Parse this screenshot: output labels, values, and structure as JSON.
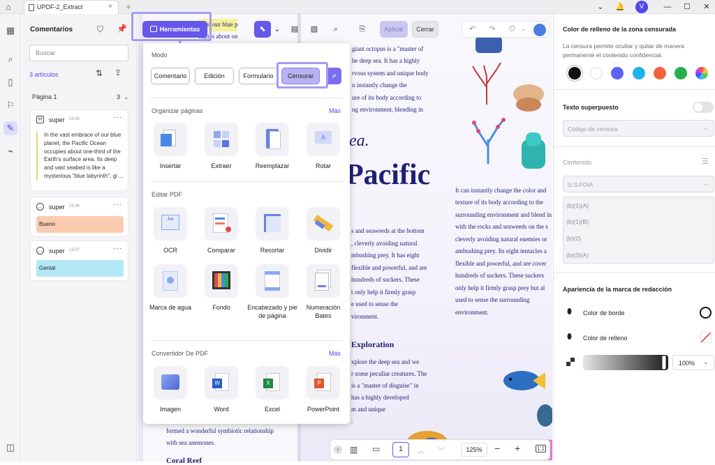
{
  "titlebar": {
    "tab_title": "UPDF-2_Extract",
    "avatar": "V"
  },
  "sidebar": {
    "title": "Comentarios",
    "search_placeholder": "Buscar",
    "count": "3 artículos",
    "page_label": "Página 1",
    "page_count": "3"
  },
  "comments": [
    {
      "user": "super",
      "time": "15:06",
      "text": "In the vast embrace of our blue planet, the Pacific Ocean occupies about one-third of the Earth's surface area. Its deep and vast seabed is like a mysterious \"blue labyrinth\", gi ..."
    },
    {
      "user": "super",
      "time": "15:06",
      "note": "Bueno",
      "note_color": "#fbcbb0"
    },
    {
      "user": "super",
      "time": "15:07",
      "note": "Genial",
      "note_color": "#b3e8f5"
    }
  ],
  "toolbar": {
    "tools_label": "Herramientas",
    "apply_label": "Aplicar",
    "close_label": "Cerrar"
  },
  "dropdown": {
    "mode_label": "Modo",
    "modes": [
      "Comentario",
      "Edición",
      "Formulario",
      "Censurar"
    ],
    "organize_label": "Organizar páginas",
    "more_label": "Más",
    "organize_tools": [
      "Insertar",
      "Extraer",
      "Reemplazar",
      "Rotar"
    ],
    "edit_label": "Editar PDF",
    "edit_tools": [
      "OCR",
      "Comparar",
      "Recortar",
      "Dividir",
      "Marca de agua",
      "Fondo",
      "Encabezado y pie de página",
      "Numeración Bates"
    ],
    "convert_label": "Convertidor De PDF",
    "convert_tools": [
      "Imagen",
      "Word",
      "Excel",
      "PowerPoint"
    ]
  },
  "document": {
    "left_top": [
      "ce of our blue p",
      "cupies about on"
    ],
    "center_top": [
      "giant octopus is a \"master of",
      "he deep sea. It has a highly",
      "rvous system and unique body",
      "n instantly change the",
      "ure of its body according to",
      "ng environment, blending in"
    ],
    "heading_ea": "ea.",
    "heading_pacific": "Pacific",
    "center_mid": [
      "s and seaweeds at the bottom",
      ", cleverly avoiding natural",
      "mbushing prey. It has eight",
      "flexible and powerful, and are",
      "hundreds of suckers. These",
      "t only help it firmly grasp",
      "e used to sense the",
      "vironment."
    ],
    "heading_exploration": "Exploration",
    "center_bottom": [
      "xplore the deep sea and we",
      "r some peculiar creatures. The",
      "is a \"master of disguise\" in",
      "has a highly developed",
      "m and unique",
      "."
    ],
    "right_col": [
      "It can instantly change the color and",
      "texture of its body according to the",
      "surrounding environment and blend in",
      "with the rocks and seaweeds on the s",
      "cleverly avoiding natural enemies or",
      "ambushing prey. Its eight tentacles a",
      "flexible and powerful, and are cover",
      "hundreds of suckers. These suckers",
      "only help it firmly grasp prey but al",
      "used to sense the surrounding",
      "environment."
    ],
    "left_bottom": [
      "formed a wonderful symbiotic relationship",
      "with sea anemones."
    ],
    "left_cut": "Coral Reef"
  },
  "zoombar": {
    "page": "1",
    "zoom": "125%"
  },
  "right_panel": {
    "fill_title": "Color de relleno de la zona censurada",
    "fill_desc": "La censura permite ocultar y quitar de manera permanente el contenido confidencial.",
    "swatches": [
      "#111111",
      "#ffffff",
      "#5b63f5",
      "#1eb3e8",
      "#f2603c",
      "#26b04d",
      "rainbow"
    ],
    "overlay_label": "Texto superpuesto",
    "code_placeholder": "Código de censura",
    "content_label": "Contenido",
    "content_select": "U.S.FOIA",
    "codes": [
      "(b)(1)(A)",
      "(b)(1)(B)",
      "(b)(2)",
      "(b)(3)(A)"
    ],
    "appearance_label": "Apariencia de la marca de redacción",
    "border_color_label": "Color de borde",
    "fill_color_label": "Color de relleno",
    "opacity": "100%"
  }
}
